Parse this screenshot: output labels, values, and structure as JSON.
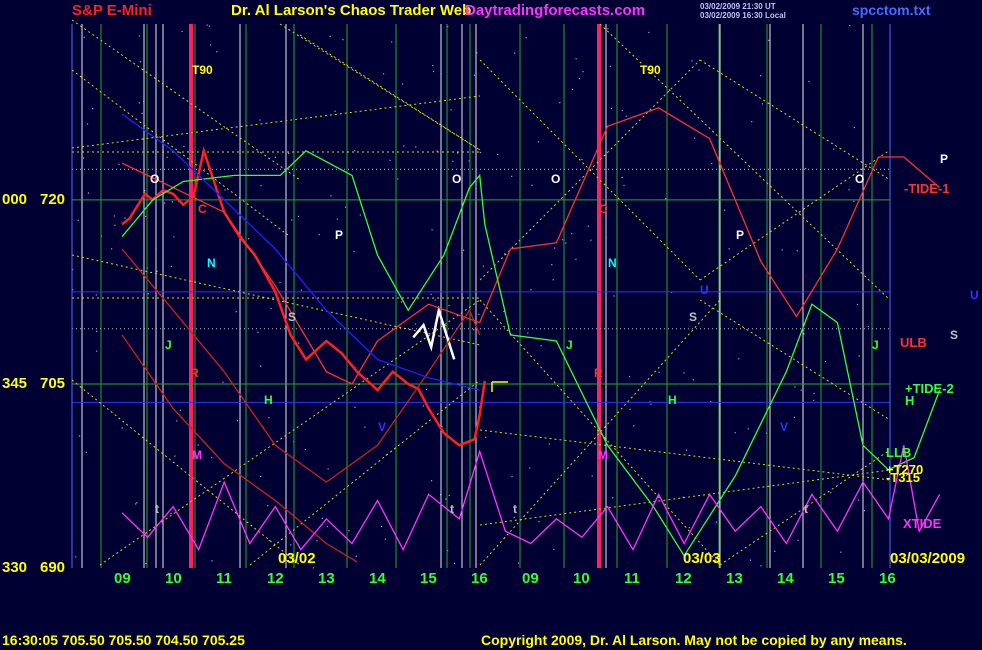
{
  "header": {
    "symbol": "S&P E-Mini",
    "title": "Dr. Al Larson's Chaos Trader Web",
    "site": "Daytradingforecasts.com",
    "time_line_1": "03/02/2009 21:30 UT",
    "time_line_2": "03/02/2009 16:30 Local",
    "file": "spcctom.txt"
  },
  "footer": {
    "quote": "16:30:05  705.50  705.50  704.50  705.25",
    "copyright": "Copyright 2009, Dr. Al Larson. May not be copied by any means."
  },
  "chart_data": {
    "type": "line",
    "y_ticks": [
      {
        "left": "000",
        "right": "720",
        "value": 720
      },
      {
        "left": "345",
        "right": "705",
        "value": 705
      },
      {
        "left": "330",
        "right": "690",
        "value": 690
      }
    ],
    "ylim": [
      690,
      727.5
    ],
    "x_tick_labels": [
      "09",
      "10",
      "11",
      "12",
      "13",
      "14",
      "15",
      "16",
      "09",
      "10",
      "11",
      "12",
      "13",
      "14",
      "15",
      "16"
    ],
    "date_labels": [
      "03/02",
      "03/03",
      "03/03/2009"
    ],
    "right_labels": [
      {
        "text": "-TIDE-1",
        "color": "#ff3030"
      },
      {
        "text": "ULB",
        "color": "#ff3030"
      },
      {
        "text": "+TIDE-2",
        "color": "#33ff33"
      },
      {
        "text": "H",
        "color": "#33ff33"
      },
      {
        "text": "LLB",
        "color": "#33ff33"
      },
      {
        "text": "+T270",
        "color": "#ffff00"
      },
      {
        "text": "-T315",
        "color": "#ffff00"
      },
      {
        "text": "XTIDE",
        "color": "#ff33ff"
      }
    ],
    "markers": [
      {
        "text": "T90",
        "color": "#ffff00"
      },
      {
        "text": "T90",
        "color": "#ffff00"
      },
      {
        "text": "O",
        "color": "#ffffff"
      },
      {
        "text": "O",
        "color": "#ffffff"
      },
      {
        "text": "O",
        "color": "#ffffff"
      },
      {
        "text": "O",
        "color": "#ffffff"
      },
      {
        "text": "C",
        "color": "#ff3030"
      },
      {
        "text": "C",
        "color": "#ff3030"
      },
      {
        "text": "N",
        "color": "#00ffff"
      },
      {
        "text": "N",
        "color": "#00ffff"
      },
      {
        "text": "P",
        "color": "#ffffff"
      },
      {
        "text": "P",
        "color": "#ffffff"
      },
      {
        "text": "P",
        "color": "#ffffff"
      },
      {
        "text": "S",
        "color": "#c0c0c0"
      },
      {
        "text": "S",
        "color": "#c0c0c0"
      },
      {
        "text": "S",
        "color": "#c0c0c0"
      },
      {
        "text": "U",
        "color": "#3333ff"
      },
      {
        "text": "U",
        "color": "#3333ff"
      },
      {
        "text": "J",
        "color": "#33ff33"
      },
      {
        "text": "J",
        "color": "#33ff33"
      },
      {
        "text": "J",
        "color": "#33ff33"
      },
      {
        "text": "R",
        "color": "#ff3030"
      },
      {
        "text": "R",
        "color": "#ff3030"
      },
      {
        "text": "H",
        "color": "#33ff33"
      },
      {
        "text": "H",
        "color": "#33ff33"
      },
      {
        "text": "V",
        "color": "#3333ff"
      },
      {
        "text": "V",
        "color": "#3333ff"
      },
      {
        "text": "M",
        "color": "#ff33ff"
      },
      {
        "text": "M",
        "color": "#ff33ff"
      },
      {
        "text": "t",
        "color": "#c0c0c0"
      },
      {
        "text": "t",
        "color": "#c0c0c0"
      },
      {
        "text": "t",
        "color": "#c0c0c0"
      },
      {
        "text": "t",
        "color": "#c0c0c0"
      }
    ],
    "series": [
      {
        "name": "S&P E-Mini",
        "color": "#ff2020",
        "points": [
          [
            0,
            718
          ],
          [
            0.15,
            718.5
          ],
          [
            0.3,
            719.5
          ],
          [
            0.45,
            720.5
          ],
          [
            0.6,
            720
          ],
          [
            0.8,
            720.8
          ],
          [
            1.0,
            720.5
          ],
          [
            1.2,
            719.6
          ],
          [
            1.4,
            720.3
          ],
          [
            1.6,
            724
          ],
          [
            1.8,
            721.5
          ],
          [
            2.0,
            719
          ],
          [
            2.3,
            717
          ],
          [
            2.6,
            715.5
          ],
          [
            3.0,
            712.5
          ],
          [
            3.3,
            709
          ],
          [
            3.6,
            707
          ],
          [
            4.0,
            708.5
          ],
          [
            4.3,
            707.5
          ],
          [
            4.6,
            706
          ],
          [
            5.0,
            704.5
          ],
          [
            5.3,
            706
          ],
          [
            5.6,
            705
          ],
          [
            5.8,
            704.6
          ],
          [
            6.0,
            703
          ],
          [
            6.3,
            701
          ],
          [
            6.6,
            700
          ],
          [
            6.9,
            700.5
          ],
          [
            7.0,
            702.5
          ],
          [
            7.1,
            705.25
          ]
        ]
      },
      {
        "name": "white bars",
        "color": "#ffffff",
        "points": [
          [
            5.7,
            708.8
          ],
          [
            5.9,
            709.8
          ],
          [
            6.05,
            708
          ],
          [
            6.2,
            711
          ],
          [
            6.35,
            709
          ],
          [
            6.5,
            707
          ]
        ]
      },
      {
        "name": "-TIDE-1",
        "color": "#ff3030",
        "points": [
          [
            0,
            723
          ],
          [
            1.0,
            721
          ],
          [
            2.0,
            719
          ],
          [
            3.0,
            713
          ],
          [
            4.0,
            706
          ],
          [
            4.5,
            705
          ],
          [
            5.0,
            708.5
          ],
          [
            6.0,
            711.5
          ],
          [
            7.0,
            710
          ],
          [
            7.6,
            716
          ],
          [
            8.5,
            716.5
          ],
          [
            9.5,
            726
          ],
          [
            10.5,
            727.5
          ],
          [
            11.5,
            725
          ],
          [
            12.5,
            715
          ],
          [
            13.2,
            710.5
          ],
          [
            14.0,
            716
          ],
          [
            14.8,
            723.5
          ],
          [
            15.3,
            723.5
          ],
          [
            16.0,
            721
          ]
        ]
      },
      {
        "name": "+TIDE-2",
        "color": "#33ff33",
        "points": [
          [
            0,
            717
          ],
          [
            0.6,
            720
          ],
          [
            1.2,
            721.5
          ],
          [
            2.2,
            722
          ],
          [
            3.1,
            722
          ],
          [
            3.6,
            724
          ],
          [
            4.5,
            722
          ],
          [
            5.0,
            715.5
          ],
          [
            5.6,
            711
          ],
          [
            6.3,
            715.5
          ],
          [
            6.8,
            721
          ],
          [
            7.0,
            722
          ],
          [
            7.1,
            718
          ],
          [
            7.6,
            709
          ],
          [
            8.5,
            708.5
          ],
          [
            9.5,
            700
          ],
          [
            10.4,
            695
          ],
          [
            11.0,
            691
          ],
          [
            12.0,
            697.5
          ],
          [
            13.0,
            706
          ],
          [
            13.5,
            711.5
          ],
          [
            14.0,
            710
          ],
          [
            14.5,
            700
          ],
          [
            15.0,
            698
          ],
          [
            15.5,
            699
          ],
          [
            16.0,
            704.5
          ]
        ]
      },
      {
        "name": "ULB",
        "color": "#cc2020",
        "points": [
          [
            0,
            716
          ],
          [
            1.0,
            711
          ],
          [
            2.0,
            706
          ],
          [
            3.0,
            700
          ],
          [
            4.0,
            697
          ],
          [
            5.0,
            700
          ],
          [
            6.0,
            706
          ],
          [
            6.8,
            711
          ],
          [
            7.0,
            709
          ]
        ]
      },
      {
        "name": "LLB",
        "color": "#cc2020",
        "points": [
          [
            0,
            709
          ],
          [
            1.0,
            703
          ],
          [
            2.0,
            698.5
          ],
          [
            3.0,
            695.5
          ],
          [
            4.0,
            692
          ],
          [
            4.6,
            690.5
          ]
        ]
      },
      {
        "name": "blue",
        "color": "#2020ff",
        "points": [
          [
            0,
            727
          ],
          [
            1.0,
            724
          ],
          [
            2.0,
            720
          ],
          [
            3.0,
            716
          ],
          [
            4.0,
            711
          ],
          [
            5.0,
            707
          ],
          [
            6.0,
            705.5
          ],
          [
            7.0,
            704.5
          ]
        ]
      },
      {
        "name": "XTIDE",
        "color": "#ff33ff",
        "points": [
          [
            0,
            694.5
          ],
          [
            0.5,
            692.5
          ],
          [
            1.0,
            695
          ],
          [
            1.5,
            691.5
          ],
          [
            2.0,
            697
          ],
          [
            2.5,
            692
          ],
          [
            3.0,
            695
          ],
          [
            3.5,
            691.5
          ],
          [
            4.0,
            694
          ],
          [
            4.5,
            692
          ],
          [
            5.0,
            695.5
          ],
          [
            5.5,
            691.5
          ],
          [
            6.0,
            696
          ],
          [
            6.6,
            694
          ],
          [
            7.0,
            699.5
          ],
          [
            7.5,
            693
          ],
          [
            8.0,
            692
          ],
          [
            8.5,
            694
          ],
          [
            9.0,
            692.5
          ],
          [
            9.5,
            695
          ],
          [
            10.0,
            691.5
          ],
          [
            10.5,
            696
          ],
          [
            11.0,
            692
          ],
          [
            11.5,
            696
          ],
          [
            12.0,
            693
          ],
          [
            12.5,
            695
          ],
          [
            13.0,
            692
          ],
          [
            13.5,
            696
          ],
          [
            14.0,
            693
          ],
          [
            14.5,
            697
          ],
          [
            15.0,
            694
          ],
          [
            15.3,
            700
          ],
          [
            15.6,
            693
          ],
          [
            16.0,
            696
          ]
        ]
      }
    ]
  }
}
